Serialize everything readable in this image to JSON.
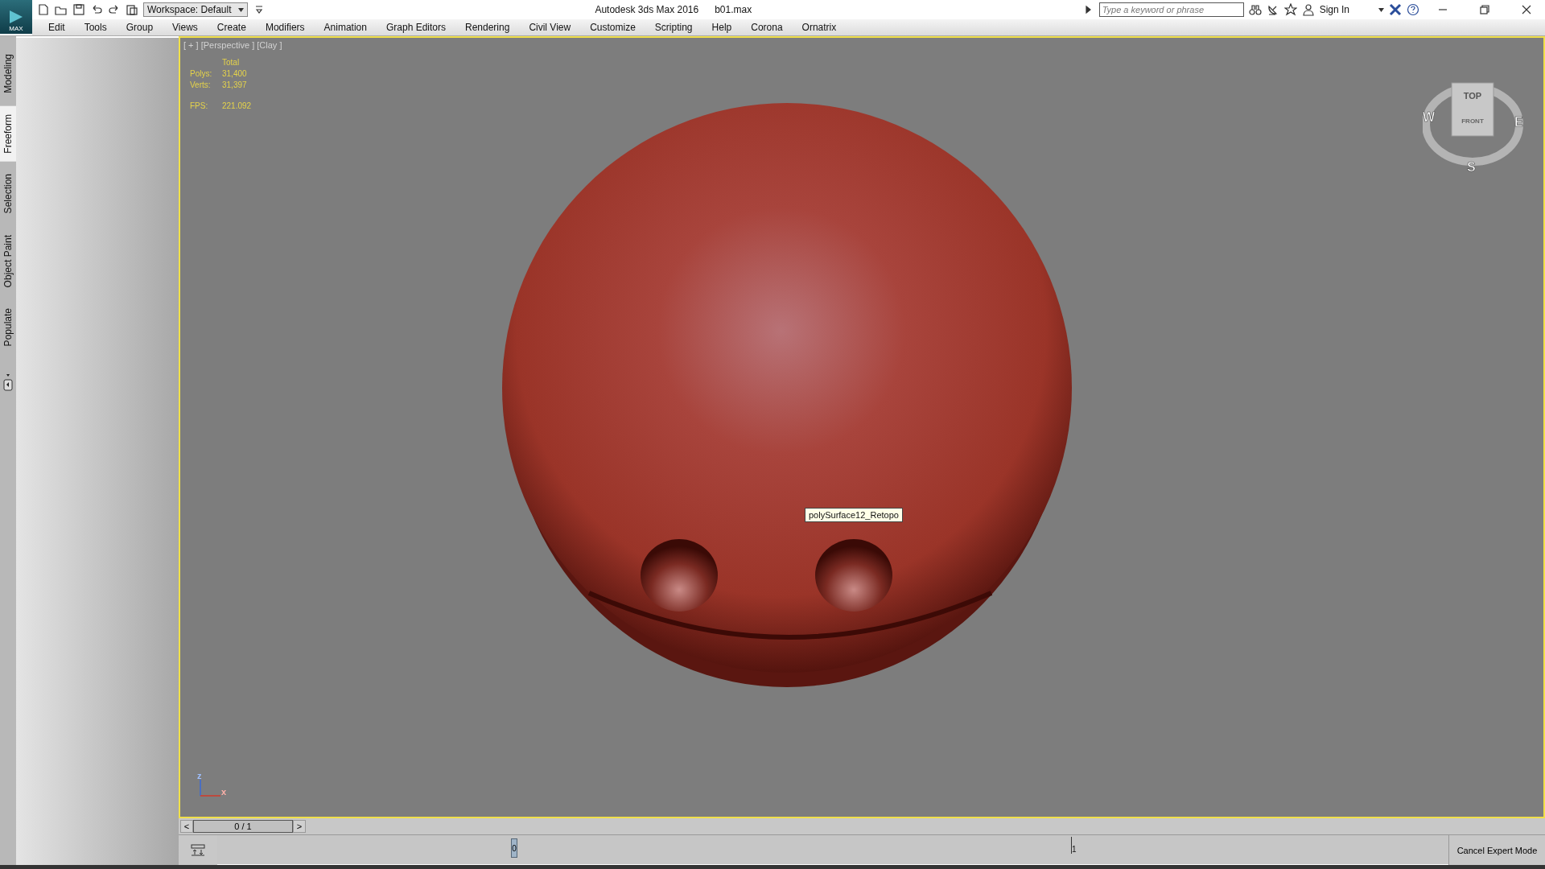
{
  "title_bar": {
    "logo_label": "MAX",
    "workspace": "Workspace: Default",
    "app_title": "Autodesk 3ds Max 2016",
    "file_name": "b01.max",
    "search": {
      "placeholder": "Type a keyword or phrase"
    },
    "sign_in": "Sign In"
  },
  "menu": [
    "Edit",
    "Tools",
    "Group",
    "Views",
    "Create",
    "Modifiers",
    "Animation",
    "Graph Editors",
    "Rendering",
    "Civil View",
    "Customize",
    "Scripting",
    "Help",
    "Corona",
    "Ornatrix"
  ],
  "command_tabs": [
    {
      "label": "Modeling",
      "selected": false
    },
    {
      "label": "Freeform",
      "selected": true
    },
    {
      "label": "Selection",
      "selected": false
    },
    {
      "label": "Object Paint",
      "selected": false
    },
    {
      "label": "Populate",
      "selected": false
    }
  ],
  "viewport": {
    "active": true,
    "labels": [
      "[ + ]",
      "[Perspective ]",
      "[Clay ]"
    ],
    "stats": {
      "header": "Total",
      "geometry": [
        {
          "label": "Polys:",
          "value": "31,400"
        },
        {
          "label": "Verts:",
          "value": "31,397"
        }
      ],
      "fps": {
        "label": "FPS:",
        "value": "221.092"
      }
    },
    "tooltip": "polySurface12_Retopo",
    "viewcube": {
      "top": "TOP",
      "front": "FRONT",
      "west": "W",
      "east": "E",
      "south": "S"
    },
    "axis": {
      "z": "z",
      "x": "x"
    }
  },
  "time_slider": {
    "prev": "<",
    "position": "0 / 1",
    "next": ">"
  },
  "track_bar": {
    "current_frame": "0",
    "end_tick": "1"
  },
  "cancel_expert_mode": "Cancel Expert Mode"
}
